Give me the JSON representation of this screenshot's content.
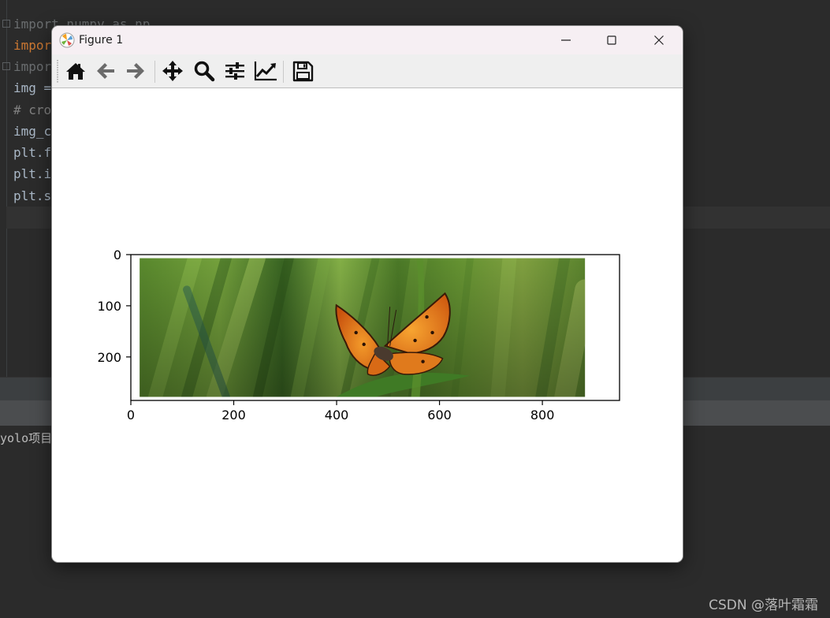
{
  "ide": {
    "code_lines": [
      "import numpy as np",
      "impor",
      "impor",
      "img =",
      "# cro",
      "img_c",
      "plt.f",
      "plt.i",
      "plt.s"
    ],
    "console_text": "yolo项目",
    "watermark": "CSDN @落叶霜霜"
  },
  "window": {
    "title": "Figure 1",
    "minimize_label": "Minimize",
    "maximize_label": "Maximize",
    "close_label": "Close"
  },
  "toolbar": {
    "buttons": [
      {
        "name": "home",
        "icon": "home-icon",
        "title": "Reset original view"
      },
      {
        "name": "back",
        "icon": "arrow-left-icon",
        "title": "Back to previous view"
      },
      {
        "name": "forward",
        "icon": "arrow-right-icon",
        "title": "Forward to next view"
      },
      {
        "name": "pan",
        "icon": "move-icon",
        "title": "Pan axes"
      },
      {
        "name": "zoom",
        "icon": "magnifier-icon",
        "title": "Zoom to rectangle"
      },
      {
        "name": "subplots",
        "icon": "sliders-icon",
        "title": "Configure subplots"
      },
      {
        "name": "customize",
        "icon": "line-chart-icon",
        "title": "Edit axis, curve and image parameters"
      },
      {
        "name": "save",
        "icon": "floppy-disk-icon",
        "title": "Save the figure"
      }
    ]
  },
  "chart_data": {
    "type": "image",
    "title": "",
    "xlabel": "",
    "ylabel": "",
    "x_ticks": [
      0,
      200,
      400,
      600,
      800
    ],
    "y_ticks": [
      0,
      100,
      200
    ],
    "xlim": [
      0,
      950
    ],
    "ylim": [
      285,
      0
    ],
    "image_extent": {
      "x": [
        17,
        883
      ],
      "y": [
        7,
        278
      ]
    },
    "image_content": "orange butterfly on green grass"
  },
  "colors": {
    "ide_bg": "#2b2b2b",
    "keyword": "#cc7832",
    "titlebar": "#f6eff3",
    "toolbar": "#efefef"
  }
}
